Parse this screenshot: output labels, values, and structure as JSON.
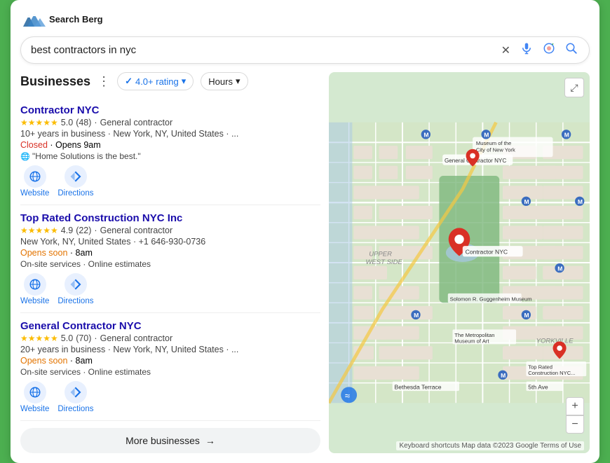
{
  "logo": {
    "text_line1": "Search Berg",
    "alt": "Search Berg Logo"
  },
  "search": {
    "query": "best contractors in nyc",
    "placeholder": "best contractors in nyc"
  },
  "businesses_section": {
    "title": "Businesses",
    "filter_rating": "4.0+ rating",
    "filter_hours": "Hours",
    "businesses": [
      {
        "name": "Contractor NYC",
        "rating": "5.0",
        "stars": 5,
        "review_count": "48",
        "type": "General contractor",
        "meta": "10+ years in business · New York, NY, United States · ...",
        "status": "Closed",
        "status_type": "closed",
        "status_extra": "Opens 9am",
        "note": "\"Home Solutions is the best.\"",
        "has_globe": true
      },
      {
        "name": "Top Rated Construction NYC Inc",
        "rating": "4.9",
        "stars": 5,
        "review_count": "22",
        "type": "General contractor",
        "meta": "New York, NY, United States · +1 646-930-0736",
        "status": "Opens soon",
        "status_type": "open-soon",
        "status_extra": "8am",
        "note": "On-site services · Online estimates",
        "has_globe": false
      },
      {
        "name": "General Contractor NYC",
        "rating": "5.0",
        "stars": 5,
        "review_count": "70",
        "type": "General contractor",
        "meta": "20+ years in business · New York, NY, United States · ...",
        "status": "Opens soon",
        "status_type": "open-soon",
        "status_extra": "8am",
        "note": "On-site services · Online estimates",
        "has_globe": false
      }
    ],
    "more_button": "More businesses",
    "website_label": "Website",
    "directions_label": "Directions"
  },
  "map": {
    "footer": "Keyboard shortcuts  Map data ©2023 Google  Terms of Use"
  }
}
